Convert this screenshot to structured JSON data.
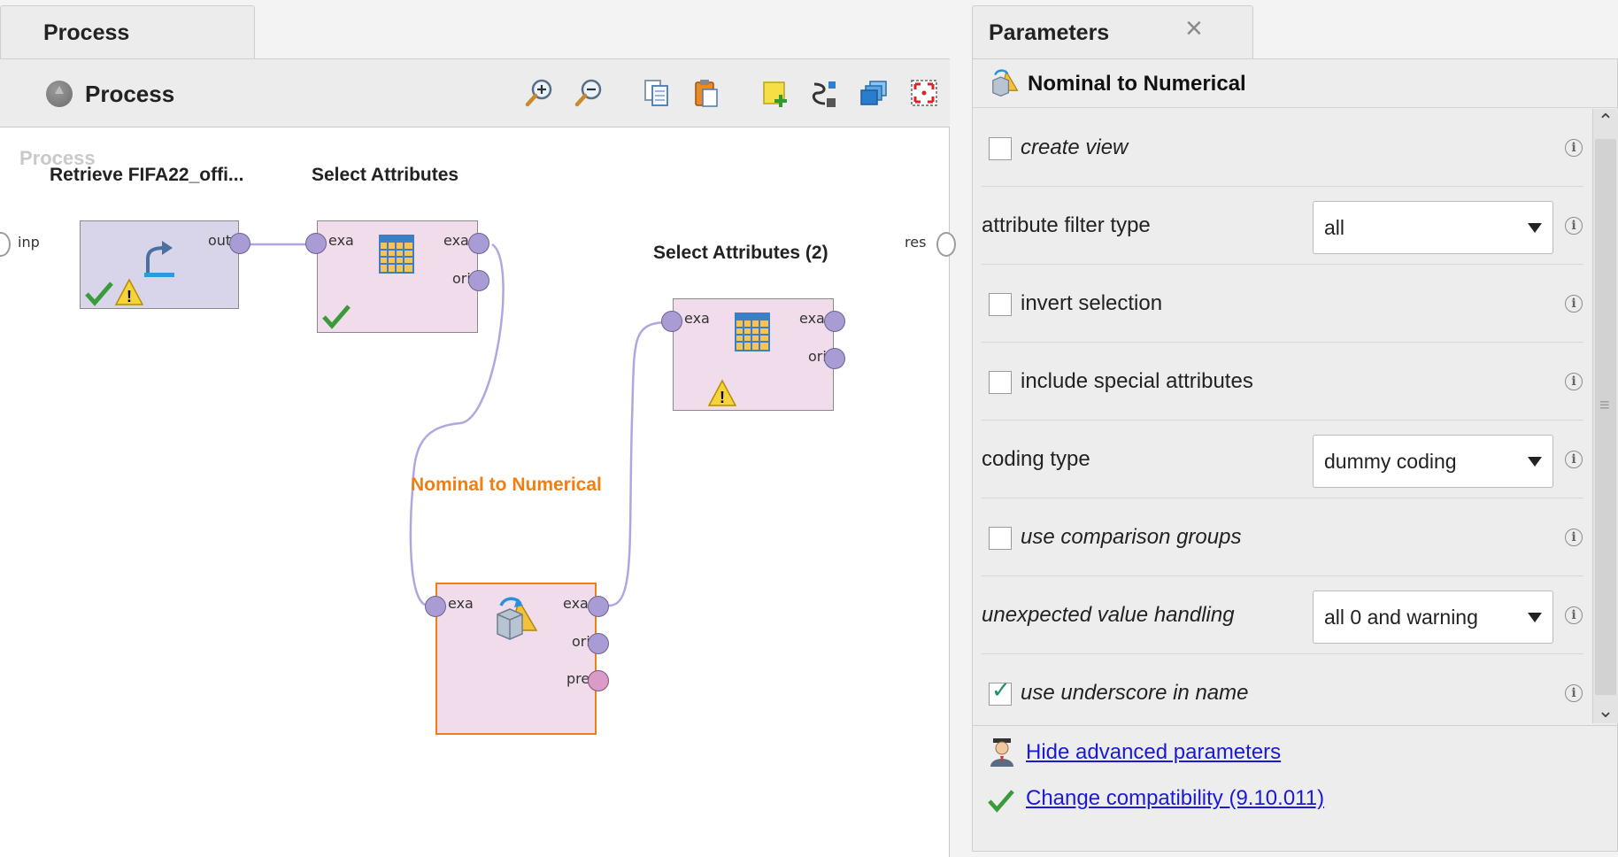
{
  "process_panel": {
    "tab_title": "Process",
    "breadcrumb": "Process",
    "canvas_title": "Process",
    "toolbar_icons": [
      "zoom-in-icon",
      "zoom-out-icon",
      "copy-icon",
      "paste-icon",
      "add-note-icon",
      "auto-wire-icon",
      "layers-icon",
      "fit-screen-icon"
    ],
    "process_ports": {
      "input": "inp",
      "result": "res"
    },
    "operators": [
      {
        "name": "Retrieve FIFA22_offi...",
        "inputs": [],
        "outputs": [
          "out"
        ],
        "status": [
          "ok",
          "warning"
        ],
        "color": "#d8d4e9"
      },
      {
        "name": "Select Attributes",
        "inputs": [
          "exa"
        ],
        "outputs": [
          "exa",
          "ori"
        ],
        "status": [
          "ok"
        ],
        "color": "#f0dcea"
      },
      {
        "name": "Select Attributes (2)",
        "inputs": [
          "exa"
        ],
        "outputs": [
          "exa",
          "ori"
        ],
        "status": [
          "warning"
        ],
        "color": "#f0dcea"
      },
      {
        "name": "Nominal to Numerical",
        "inputs": [
          "exa"
        ],
        "outputs": [
          "exa",
          "ori",
          "pre"
        ],
        "status": [],
        "color": "#f0dcea",
        "selected": true
      }
    ]
  },
  "parameters_panel": {
    "tab_title": "Parameters",
    "operator_name": "Nominal to Numerical",
    "params": [
      {
        "type": "checkbox",
        "label": "create view",
        "checked": false,
        "italic": true
      },
      {
        "type": "select",
        "label": "attribute filter type",
        "value": "all",
        "italic": false
      },
      {
        "type": "checkbox",
        "label": "invert selection",
        "checked": false,
        "italic": false
      },
      {
        "type": "checkbox",
        "label": "include special attributes",
        "checked": false,
        "italic": false
      },
      {
        "type": "select",
        "label": "coding type",
        "value": "dummy coding",
        "italic": false
      },
      {
        "type": "checkbox",
        "label": "use comparison groups",
        "checked": false,
        "italic": true
      },
      {
        "type": "select",
        "label": "unexpected value handling",
        "value": "all 0 and warning",
        "italic": true
      },
      {
        "type": "checkbox",
        "label": "use underscore in name",
        "checked": true,
        "italic": true
      }
    ],
    "links": {
      "advanced": "Hide advanced parameters",
      "compatibility": "Change compatibility (9.10.011)"
    }
  },
  "colors": {
    "selected_operator": "#f07f12",
    "port": "#a99bd4",
    "link": "#1a1ad6"
  }
}
